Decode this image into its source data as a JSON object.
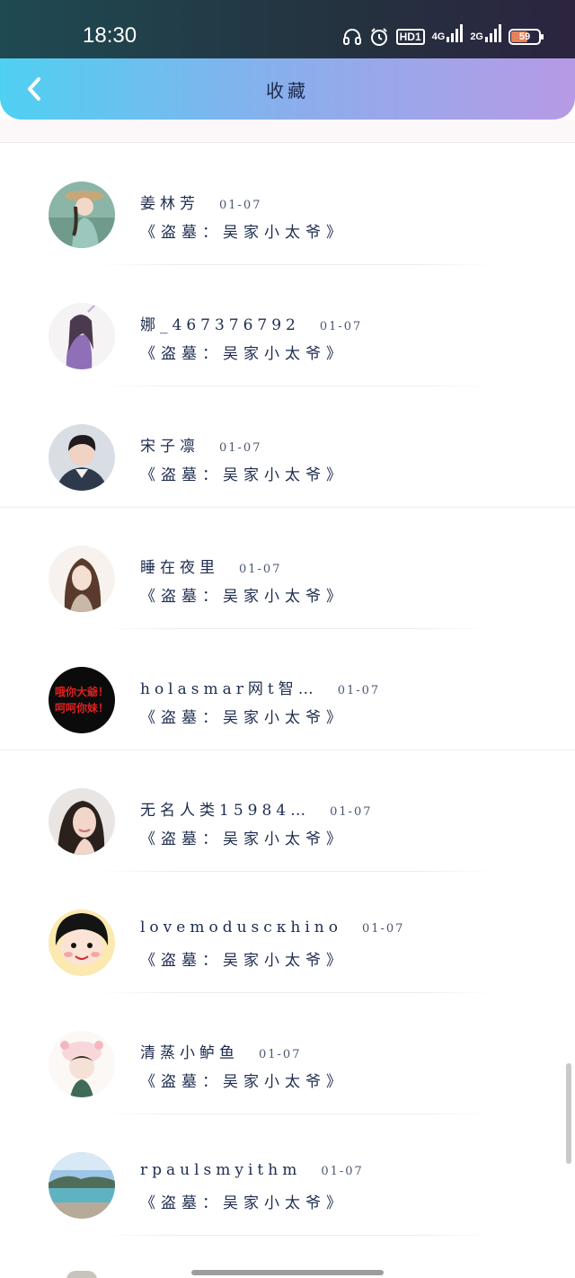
{
  "status_bar": {
    "time": "18:30",
    "icons": [
      "headset-icon",
      "alarm-icon",
      "hd-icon",
      "signal-4g-icon",
      "signal-2g-icon",
      "battery-icon"
    ],
    "hd_label": "HD1",
    "net1": "4G",
    "net2": "2G",
    "battery_level": "59"
  },
  "header": {
    "title": "收藏",
    "back_icon": "chevron-left-icon",
    "gradient": [
      "#4fd0f2",
      "#b79ae6"
    ]
  },
  "favorites": [
    {
      "user": "姜林芳",
      "date": "01-07",
      "book": "《盗墓：吴家小太爷》"
    },
    {
      "user": "娜_467376792",
      "date": "01-07",
      "book": "《盗墓：吴家小太爷》"
    },
    {
      "user": "宋子凛",
      "date": "01-07",
      "book": "《盗墓：吴家小太爷》"
    },
    {
      "user": "睡在夜里",
      "date": "01-07",
      "book": "《盗墓：吴家小太爷》"
    },
    {
      "user": "holasmar网t智…",
      "date": "01-07",
      "book": "《盗墓：吴家小太爷》"
    },
    {
      "user": "无名人类15984…",
      "date": "01-07",
      "book": "《盗墓：吴家小太爷》"
    },
    {
      "user": "lovemoduscкhino",
      "date": "01-07",
      "book": "《盗墓：吴家小太爷》"
    },
    {
      "user": "清蒸小鲈鱼",
      "date": "01-07",
      "book": "《盗墓：吴家小太爷》"
    },
    {
      "user": "rpaulsmyithm",
      "date": "01-07",
      "book": "《盗墓：吴家小太爷》"
    }
  ],
  "avatar5_text": [
    "哦你大爺！",
    "呵呵你妹！"
  ]
}
